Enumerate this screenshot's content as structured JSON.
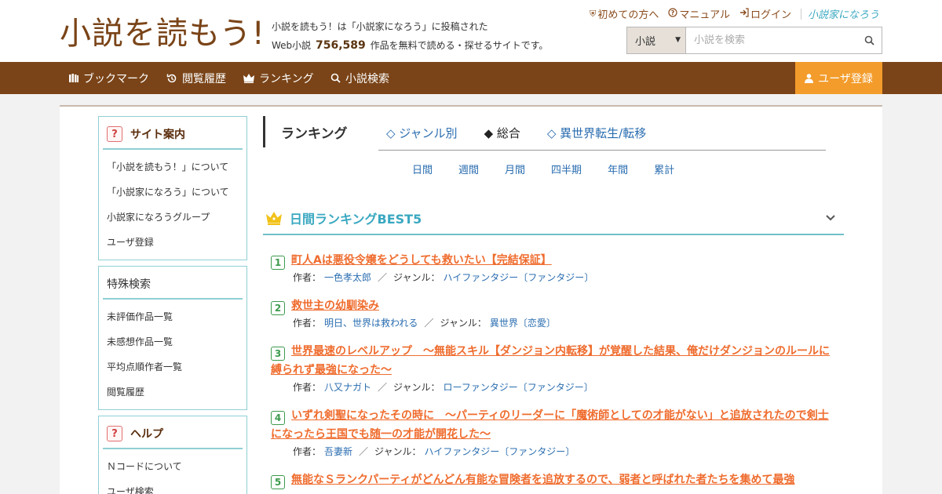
{
  "header": {
    "logo_text": "小説を読もう!",
    "tagline_line1": "小説を読もう！は「小説家になろう」に投稿された",
    "tagline_prefix": "Web小説",
    "work_count": "756,589",
    "tagline_suffix": "作品を無料で読める・探せるサイトです。",
    "top_links": [
      {
        "label": "初めての方へ",
        "icon": "shield-icon"
      },
      {
        "label": "マニュアル",
        "icon": "question-circle-icon"
      },
      {
        "label": "ログイン",
        "icon": "login-icon"
      }
    ],
    "brand_link": "小説家になろう",
    "search": {
      "category": "小説",
      "placeholder": "小説を検索"
    }
  },
  "nav": {
    "items": [
      {
        "label": "ブックマーク",
        "icon": "bookshelf-icon"
      },
      {
        "label": "閲覧履歴",
        "icon": "history-icon"
      },
      {
        "label": "ランキング",
        "icon": "crown-icon"
      },
      {
        "label": "小説検索",
        "icon": "search-icon"
      }
    ],
    "register": "ユーザ登録"
  },
  "sidebar": {
    "boxes": [
      {
        "title": "サイト案内",
        "bold": true,
        "items": [
          "「小説を読もう！」について",
          "「小説家になろう」について",
          "小説家になろうグループ",
          "ユーザ登録"
        ]
      },
      {
        "title": "特殊検索",
        "bold": false,
        "items": [
          "未評価作品一覧",
          "未感想作品一覧",
          "平均点順作者一覧",
          "閲覧履歴"
        ]
      },
      {
        "title": "ヘルプ",
        "bold": true,
        "items": [
          "Ｎコードについて",
          "ユーザ検索"
        ]
      }
    ]
  },
  "ranking": {
    "heading": "ランキング",
    "tabs": [
      {
        "label": "◇ ジャンル別",
        "active": false
      },
      {
        "label": "◆ 総合",
        "active": true
      },
      {
        "label": "◇ 異世界転生/転移",
        "active": false
      }
    ],
    "periods": [
      "日間",
      "週間",
      "月間",
      "四半期",
      "年間",
      "累計"
    ],
    "best_title": "日間ランキングBEST5",
    "author_label": "作者：",
    "genre_label": "ジャンル：",
    "entries": [
      {
        "rank": "1",
        "title": "町人Aは悪役令嬢をどうしても救いたい【完結保証】",
        "author": "一色孝太郎",
        "genre": "ハイファンタジー〔ファンタジー〕"
      },
      {
        "rank": "2",
        "title": "救世主の幼馴染み",
        "author": "明日、世界は救われる",
        "genre": "異世界〔恋愛〕"
      },
      {
        "rank": "3",
        "title": "世界最速のレベルアップ　～無能スキル【ダンジョン内転移】が覚醒した結果、俺だけダンジョンのルールに縛られず最強になった～",
        "author": "八又ナガト",
        "genre": "ローファンタジー〔ファンタジー〕"
      },
      {
        "rank": "4",
        "title": "いずれ剣聖になったその時に　〜パーティのリーダーに「魔術師としての才能がない」と追放されたので剣士になったら王国でも随一の才能が開花した〜",
        "author": "吾妻新",
        "genre": "ハイファンタジー〔ファンタジー〕"
      },
      {
        "rank": "5",
        "title": "無能なＳランクパーティがどんどん有能な冒険者を追放するので、弱者と呼ばれた者たちを集めて最強",
        "author": "",
        "genre": ""
      }
    ]
  },
  "colors": {
    "nav_bg": "#7a4418",
    "register_bg": "#f39c2b",
    "title_link": "#ef6c2e",
    "accent_teal": "#3aa8c1"
  }
}
